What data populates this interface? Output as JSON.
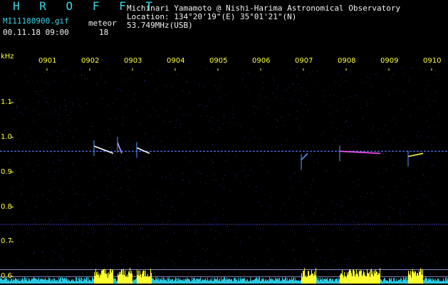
{
  "header": {
    "brand": "H R O F F T",
    "file_name": "MI11180900.gif",
    "date_time": "00.11.18 09:00",
    "meteor_label": "meteor",
    "meteor_count": "18"
  },
  "station": {
    "observer": "Michinari Yamamoto @ Nishi-Harima Astronomical Observatory",
    "location": "Location: 134°20'19\"(E) 35°01'21\"(N)",
    "frequency": "53.749MHz(USB)"
  },
  "spectrogram": {
    "y_unit": "kHz",
    "time_ticks": [
      "0901",
      "0902",
      "0903",
      "0904",
      "0905",
      "0906",
      "0907",
      "0908",
      "0909",
      "0910"
    ],
    "freq_ticks": [
      "1.1",
      "1.0",
      "0.9",
      "0.8",
      "0.7",
      "0.6"
    ],
    "freq_values": [
      1.1,
      1.0,
      0.9,
      0.8,
      0.7,
      0.6
    ],
    "freq_range": [
      0.58,
      1.2
    ],
    "time_range": [
      0,
      10
    ],
    "carrier_khz": 0.96,
    "echoes": [
      {
        "t": 1.1,
        "f": 0.975,
        "dur": 0.45,
        "color": "#ffffff"
      },
      {
        "t": 1.65,
        "f": 0.985,
        "dur": 0.1,
        "color": "#b0a0ff"
      },
      {
        "t": 2.1,
        "f": 0.97,
        "dur": 0.3,
        "color": "#ffffff"
      },
      {
        "t": 5.95,
        "f": 0.935,
        "dur": 0.15,
        "color": "#5a9cff"
      },
      {
        "t": 6.85,
        "f": 0.96,
        "dur": 0.95,
        "color": "#ff55ff"
      },
      {
        "t": 8.45,
        "f": 0.945,
        "dur": 0.35,
        "color": "#ffff40"
      }
    ],
    "interference_khz": [
      0.75,
      0.62,
      0.6,
      0.585
    ],
    "colors": {
      "background": "#000000",
      "text_cyan": "#38d6e6",
      "text_white": "#f2f2f2",
      "tick_yellow": "#ffff3c",
      "carrier": "#5a7cff",
      "noise": "#2a2a8a"
    }
  }
}
